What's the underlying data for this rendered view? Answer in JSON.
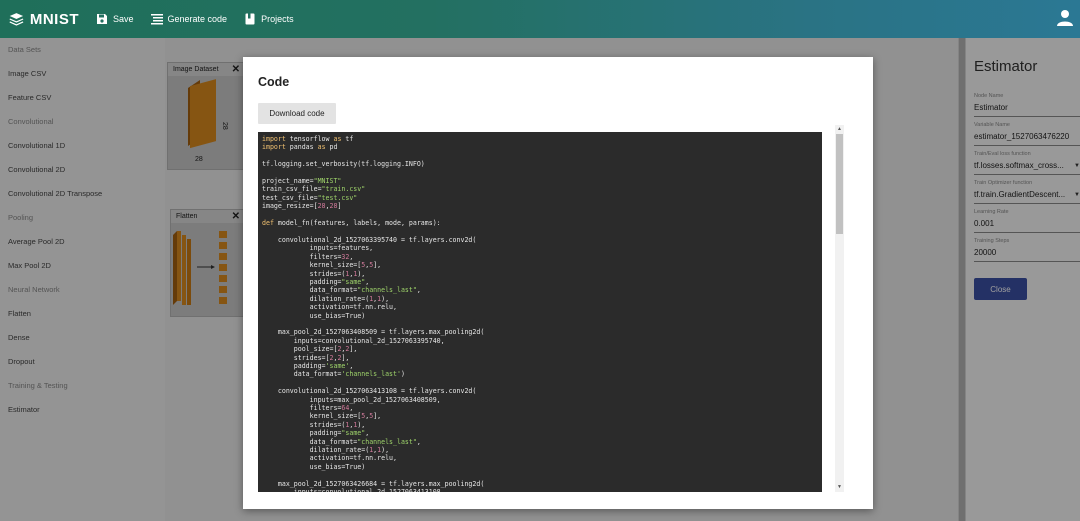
{
  "app": {
    "title": "MNIST"
  },
  "toolbar": {
    "save_label": "Save",
    "generate_label": "Generate code",
    "projects_label": "Projects"
  },
  "sidebar": {
    "items": [
      {
        "label": "Data Sets",
        "header": true
      },
      {
        "label": "Image CSV"
      },
      {
        "label": "Feature CSV"
      },
      {
        "label": "Convolutional",
        "header": true
      },
      {
        "label": "Convolutional 1D"
      },
      {
        "label": "Convolutional 2D"
      },
      {
        "label": "Convolutional 2D Transpose"
      },
      {
        "label": "Pooling",
        "header": true
      },
      {
        "label": "Average Pool 2D"
      },
      {
        "label": "Max Pool 2D"
      },
      {
        "label": "Neural Network",
        "header": true
      },
      {
        "label": "Flatten"
      },
      {
        "label": "Dense"
      },
      {
        "label": "Dropout"
      },
      {
        "label": "Training & Testing",
        "header": true
      },
      {
        "label": "Estimator"
      }
    ]
  },
  "canvas": {
    "nodes": [
      {
        "title": "Image Dataset",
        "close": "✕",
        "dim_a": "28",
        "dim_b": "28"
      },
      {
        "title": "Flatten",
        "close": "✕"
      }
    ]
  },
  "right_panel": {
    "title": "Estimator",
    "fields": [
      {
        "label": "Node Name",
        "value": "Estimator",
        "dropdown": false
      },
      {
        "label": "Variable Name",
        "value": "estimator_1527063476220",
        "dropdown": false
      },
      {
        "label": "Train/Eval loss function",
        "value": "tf.losses.softmax_cross...",
        "dropdown": true
      },
      {
        "label": "Train Optimizer function",
        "value": "tf.train.GradientDescent...",
        "dropdown": true
      },
      {
        "label": "Learning Rate",
        "value": "0.001",
        "dropdown": false
      },
      {
        "label": "Training Steps",
        "value": "20000",
        "dropdown": false
      }
    ],
    "close_label": "Close"
  },
  "modal": {
    "title": "Code",
    "download_label": "Download code",
    "code": "import tensorflow as tf\nimport pandas as pd\n\ntf.logging.set_verbosity(tf.logging.INFO)\n\nproject_name=\"MNIST\"\ntrain_csv_file=\"train.csv\"\ntest_csv_file=\"test.csv\"\nimage_resize=[28,28]\n\ndef model_fn(features, labels, mode, params):\n\n    convolutional_2d_1527063395740 = tf.layers.conv2d(\n            inputs=features,\n            filters=32,\n            kernel_size=[5,5],\n            strides=(1,1),\n            padding=\"same\",\n            data_format=\"channels_last\",\n            dilation_rate=(1,1),\n            activation=tf.nn.relu,\n            use_bias=True)\n\n    max_pool_2d_1527063408509 = tf.layers.max_pooling2d(\n        inputs=convolutional_2d_1527063395740,\n        pool_size=[2,2],\n        strides=[2,2],\n        padding='same',\n        data_format='channels_last')\n\n    convolutional_2d_1527063413108 = tf.layers.conv2d(\n            inputs=max_pool_2d_1527063408509,\n            filters=64,\n            kernel_size=[5,5],\n            strides=(1,1),\n            padding=\"same\",\n            data_format=\"channels_last\",\n            dilation_rate=(1,1),\n            activation=tf.nn.relu,\n            use_bias=True)\n\n    max_pool_2d_1527063426684 = tf.layers.max_pooling2d(\n        inputs=convolutional_2d_1527063413108,"
  },
  "colors": {
    "topbar": "#237061",
    "primary_button": "#3b4fa3",
    "node_orange": "#d98a1e",
    "code_bg": "#2b2b2b"
  }
}
